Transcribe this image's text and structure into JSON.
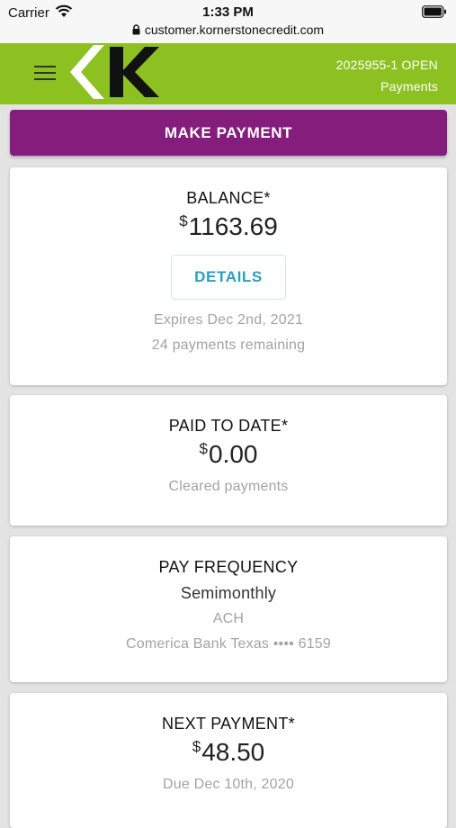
{
  "status_bar": {
    "carrier": "Carrier",
    "time": "1:33 PM",
    "url": "customer.kornerstonecredit.com"
  },
  "header": {
    "account": "2025955-1 OPEN",
    "page": "Payments",
    "brand_color": "#8dc122"
  },
  "actions": {
    "make_payment": "MAKE PAYMENT",
    "make_payment_color": "#851d7c"
  },
  "balance": {
    "title": "BALANCE*",
    "currency": "$",
    "amount": "1163.69",
    "details_label": "DETAILS",
    "expires": "Expires Dec 2nd, 2021",
    "remaining": "24 payments remaining"
  },
  "paid_to_date": {
    "title": "PAID TO DATE*",
    "currency": "$",
    "amount": "0.00",
    "note": "Cleared payments"
  },
  "pay_frequency": {
    "title": "PAY FREQUENCY",
    "value": "Semimonthly",
    "method": "ACH",
    "bank": "Comerica Bank Texas •••• 6159"
  },
  "next_payment": {
    "title": "NEXT PAYMENT*",
    "currency": "$",
    "amount": "48.50",
    "due": "Due Dec 10th, 2020"
  }
}
